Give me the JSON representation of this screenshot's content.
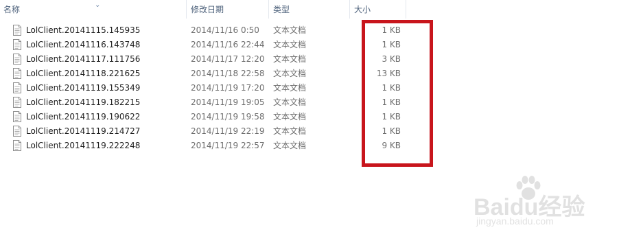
{
  "columns": {
    "name": "名称",
    "date": "修改日期",
    "type": "类型",
    "size": "大小"
  },
  "files": [
    {
      "name": "LolClient.20141115.145935",
      "date": "2014/11/16 0:50",
      "type": "文本文档",
      "size": "1 KB"
    },
    {
      "name": "LolClient.20141116.143748",
      "date": "2014/11/16 22:44",
      "type": "文本文档",
      "size": "1 KB"
    },
    {
      "name": "LolClient.20141117.111756",
      "date": "2014/11/17 12:20",
      "type": "文本文档",
      "size": "3 KB"
    },
    {
      "name": "LolClient.20141118.221625",
      "date": "2014/11/18 22:58",
      "type": "文本文档",
      "size": "13 KB"
    },
    {
      "name": "LolClient.20141119.155349",
      "date": "2014/11/19 17:20",
      "type": "文本文档",
      "size": "1 KB"
    },
    {
      "name": "LolClient.20141119.182215",
      "date": "2014/11/19 19:05",
      "type": "文本文档",
      "size": "1 KB"
    },
    {
      "name": "LolClient.20141119.190622",
      "date": "2014/11/19 19:58",
      "type": "文本文档",
      "size": "1 KB"
    },
    {
      "name": "LolClient.20141119.214727",
      "date": "2014/11/19 22:19",
      "type": "文本文档",
      "size": "1 KB"
    },
    {
      "name": "LolClient.20141119.222248",
      "date": "2014/11/19 22:57",
      "type": "文本文档",
      "size": "9 KB"
    }
  ],
  "file_icon": "text-document-icon",
  "highlight_color": "#c8151c",
  "watermark": {
    "brand": "Baidu经验",
    "url": "jingyan.baidu.com"
  }
}
